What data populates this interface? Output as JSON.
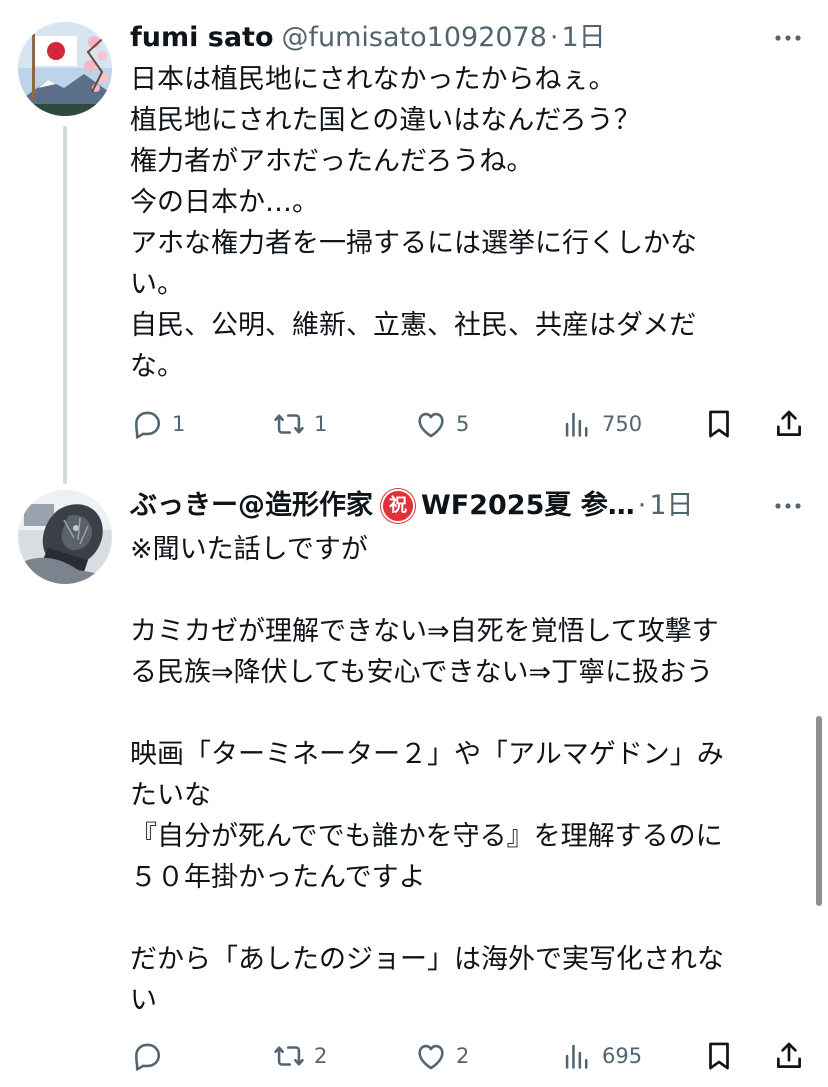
{
  "tweets": [
    {
      "display_name": "fumi sato",
      "handle": "@fumisato1092078",
      "separator": "·",
      "time": "1日",
      "avatar_icon": "flag-mountain-avatar-icon",
      "text": "日本は植民地にされなかったからねぇ。\n植民地にされた国との違いはなんだろう？\n権力者がアホだったんだろうね。\n今の日本か…。\nアホな権力者を一掃するには選挙に行くしかな\nい。\n自民、公明、維新、立憲、社民、共産はダメだ\nな。",
      "replies": "1",
      "reposts": "1",
      "likes": "5",
      "views": "750"
    },
    {
      "display_name": "ぶっきー@造形作家",
      "badge": "祝",
      "display_name_suffix": "WF2025夏 参…",
      "separator": "·",
      "time": "1日",
      "avatar_icon": "figure-sculpture-avatar-icon",
      "text": "※聞いた話しですが\n\nカミカゼが理解できない⇒自死を覚悟して攻撃す\nる民族⇒降伏しても安心できない⇒丁寧に扱おう\n\n映画「ターミネーター２」や「アルマゲドン」み\nたいな\n『自分が死んででも誰かを守る』を理解するのに\n５０年掛かったんですよ\n\nだから「あしたのジョー」は海外で実写化されな\nい",
      "replies": "",
      "reposts": "2",
      "likes": "2",
      "views": "695"
    }
  ],
  "colors": {
    "text": "#0f1419",
    "secondary": "#536471",
    "thread_line": "#cfd9de",
    "badge": "#e0303a"
  }
}
